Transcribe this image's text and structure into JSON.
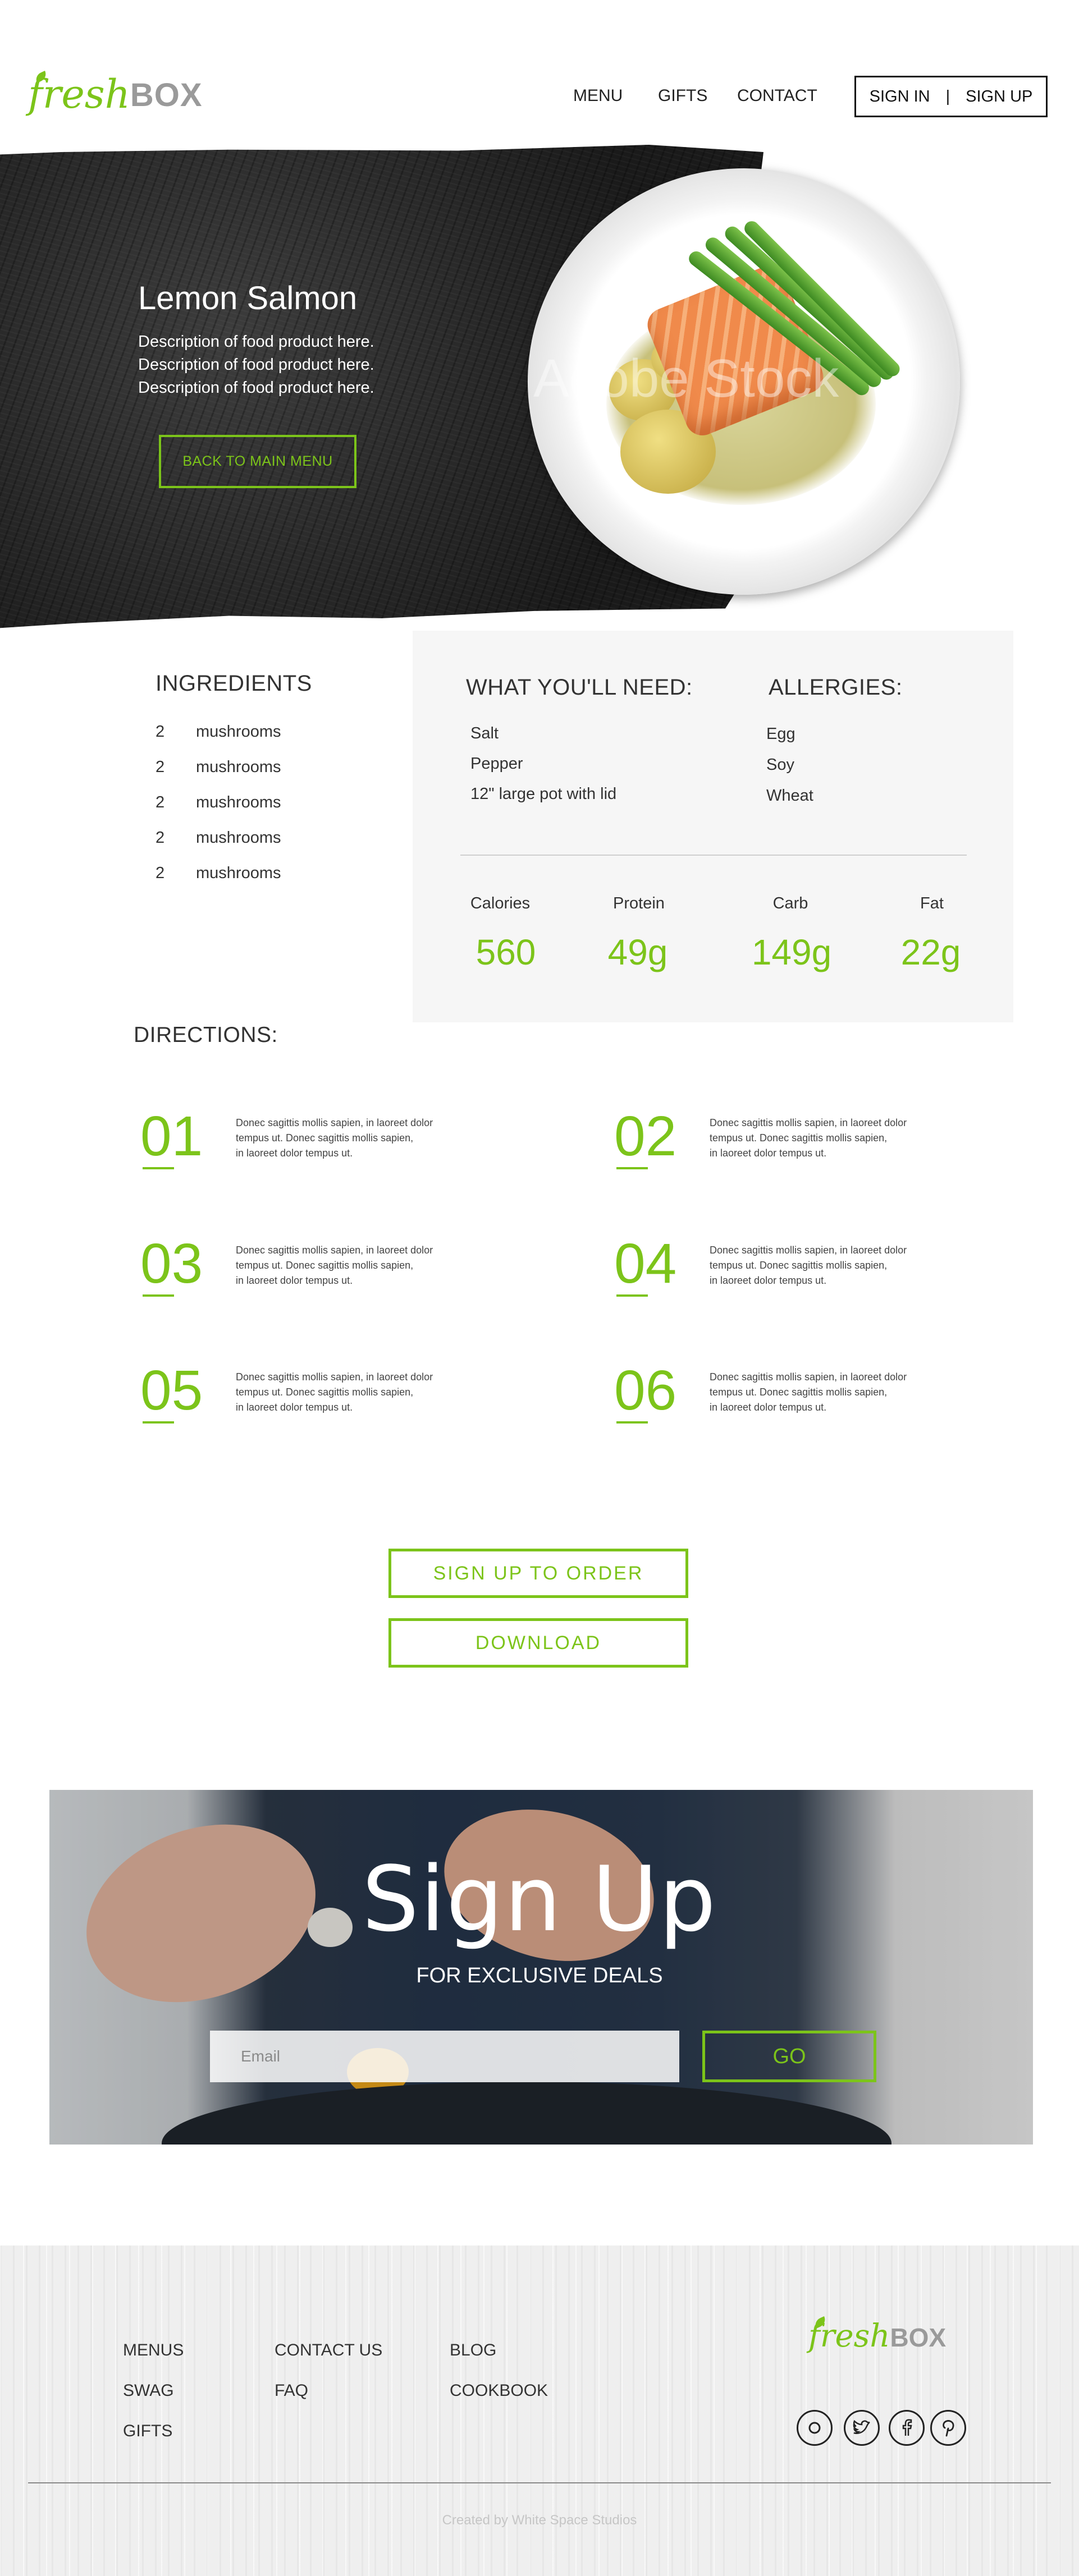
{
  "brand": {
    "logo_fresh": "fresh",
    "logo_box": "BOX",
    "accent_color": "#7cc41a"
  },
  "nav": {
    "items": [
      "MENU",
      "GIFTS",
      "CONTACT"
    ],
    "sign_in": "SIGN IN",
    "separator": "|",
    "sign_up": "SIGN UP"
  },
  "hero": {
    "title": "Lemon Salmon",
    "description_lines": [
      "Description of food product here.",
      "Description of food product here.",
      "Description of food product here."
    ],
    "back_button": "BACK TO MAIN MENU",
    "image_watermark": "Adobe Stock"
  },
  "ingredients": {
    "title": "INGREDIENTS",
    "items": [
      {
        "qty": "2",
        "name": "mushrooms"
      },
      {
        "qty": "2",
        "name": "mushrooms"
      },
      {
        "qty": "2",
        "name": "mushrooms"
      },
      {
        "qty": "2",
        "name": "mushrooms"
      },
      {
        "qty": "2",
        "name": "mushrooms"
      }
    ]
  },
  "needs": {
    "title": "WHAT YOU'LL NEED:",
    "items": [
      "Salt",
      "Pepper",
      "12\" large pot with lid"
    ]
  },
  "allergies": {
    "title": "ALLERGIES:",
    "items": [
      "Egg",
      "Soy",
      "Wheat"
    ]
  },
  "nutrition": [
    {
      "label": "Calories",
      "value": "560"
    },
    {
      "label": "Protein",
      "value": "49g"
    },
    {
      "label": "Carb",
      "value": "149g"
    },
    {
      "label": "Fat",
      "value": "22g"
    }
  ],
  "directions": {
    "title": "DIRECTIONS:",
    "steps": [
      {
        "num": "01",
        "lines": [
          "Donec sagittis mollis sapien, in laoreet dolor",
          "tempus ut. Donec sagittis mollis sapien,",
          "in laoreet dolor tempus ut."
        ]
      },
      {
        "num": "02",
        "lines": [
          "Donec sagittis mollis sapien, in laoreet dolor",
          "tempus ut. Donec sagittis mollis sapien,",
          "in laoreet dolor tempus ut."
        ]
      },
      {
        "num": "03",
        "lines": [
          "Donec sagittis mollis sapien, in laoreet dolor",
          "tempus ut. Donec sagittis mollis sapien,",
          "in laoreet dolor tempus ut."
        ]
      },
      {
        "num": "04",
        "lines": [
          "Donec sagittis mollis sapien, in laoreet dolor",
          "tempus ut. Donec sagittis mollis sapien,",
          "in laoreet dolor tempus ut."
        ]
      },
      {
        "num": "05",
        "lines": [
          "Donec sagittis mollis sapien, in laoreet dolor",
          "tempus ut. Donec sagittis mollis sapien,",
          "in laoreet dolor tempus ut."
        ]
      },
      {
        "num": "06",
        "lines": [
          "Donec sagittis mollis sapien, in laoreet dolor",
          "tempus ut. Donec sagittis mollis sapien,",
          "in laoreet dolor tempus ut."
        ]
      }
    ]
  },
  "cta": {
    "signup_order": "SIGN UP TO ORDER",
    "download": "DOWNLOAD"
  },
  "signup": {
    "title": "Sign Up",
    "subtitle": "FOR EXCLUSIVE DEALS",
    "email_placeholder": "Email",
    "go_button": "GO"
  },
  "footer": {
    "col1": [
      "MENUS",
      "SWAG",
      "GIFTS"
    ],
    "col2": [
      "CONTACT US",
      "FAQ"
    ],
    "col3": [
      "BLOG",
      "COOKBOOK"
    ],
    "social_icons": [
      "instagram-icon",
      "twitter-icon",
      "facebook-icon",
      "pinterest-icon"
    ],
    "credit": "Created by White Space Studios"
  }
}
